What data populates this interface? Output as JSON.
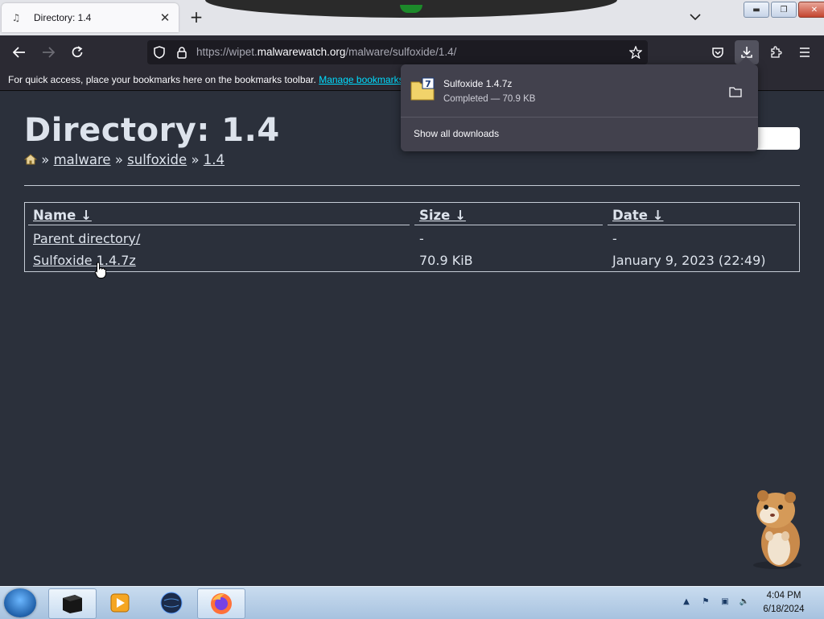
{
  "browser": {
    "tab_title": "Directory: 1.4",
    "url_host": "https://wipet.",
    "url_domain": "malwarewatch.org",
    "url_path": "/malware/sulfoxide/1.4/",
    "bookmarks_message": "For quick access, place your bookmarks here on the bookmarks toolbar.",
    "manage_bookmarks": "Manage bookmarks..."
  },
  "page": {
    "title": "Directory: 1.4",
    "breadcrumbs": {
      "sep": "»",
      "items": [
        "malware",
        "sulfoxide",
        "1.4"
      ]
    },
    "table": {
      "headers": {
        "name": "Name ↓",
        "size": "Size ↓",
        "date": "Date ↓"
      },
      "rows": [
        {
          "name": "Parent directory/",
          "size": "-",
          "date": "-"
        },
        {
          "name": "Sulfoxide 1.4.7z",
          "size": "70.9 KiB",
          "date": "January 9, 2023 (22:49)"
        }
      ]
    }
  },
  "downloads": {
    "file_name": "Sulfoxide 1.4.7z",
    "status": "Completed — 70.9 KB",
    "show_all": "Show all downloads"
  },
  "taskbar": {
    "time": "4:04 PM",
    "date": "6/18/2024"
  }
}
